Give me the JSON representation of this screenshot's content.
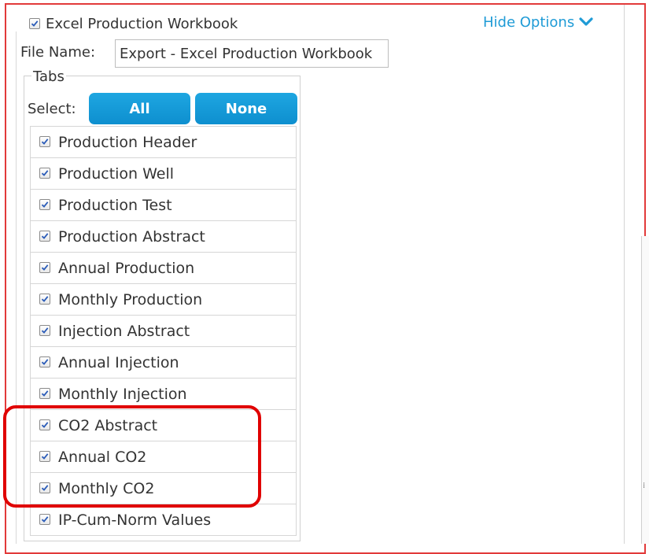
{
  "export_option": {
    "checkbox_checked": true,
    "label": "Excel Production Workbook",
    "hide_options": "Hide Options"
  },
  "file_name": {
    "label": "File Name:",
    "value": "Export - Excel Production Workbook"
  },
  "tabs": {
    "legend": "Tabs",
    "select_label": "Select:",
    "all_button": "All",
    "none_button": "None",
    "items": [
      {
        "label": "Production Header",
        "checked": true
      },
      {
        "label": "Production Well",
        "checked": true
      },
      {
        "label": "Production Test",
        "checked": true
      },
      {
        "label": "Production Abstract",
        "checked": true
      },
      {
        "label": "Annual Production",
        "checked": true
      },
      {
        "label": "Monthly Production",
        "checked": true
      },
      {
        "label": "Injection Abstract",
        "checked": true
      },
      {
        "label": "Annual Injection",
        "checked": true
      },
      {
        "label": "Monthly Injection",
        "checked": true
      },
      {
        "label": "CO2 Abstract",
        "checked": true
      },
      {
        "label": "Annual CO2",
        "checked": true
      },
      {
        "label": "Monthly CO2",
        "checked": true
      },
      {
        "label": "IP-Cum-Norm Values",
        "checked": true
      }
    ]
  },
  "colors": {
    "accent": "#1f9bd6",
    "button": "#0e8fcf",
    "annotation": "#e00000"
  },
  "icons": {
    "checkbox": "checkbox-checked-icon",
    "chevron": "chevron-down-icon"
  }
}
